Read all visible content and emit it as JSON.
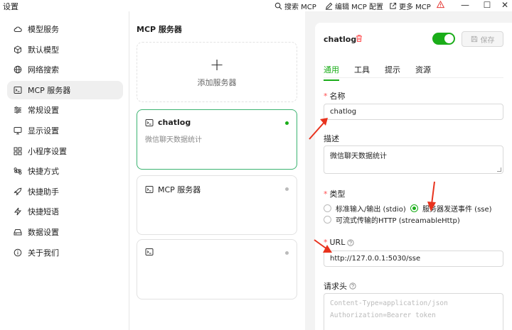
{
  "window": {
    "title": "设置",
    "actions": [
      {
        "icon": "search-icon",
        "label": "搜索 MCP"
      },
      {
        "icon": "edit-icon",
        "label": "编辑 MCP 配置"
      },
      {
        "icon": "external-link-icon",
        "label": "更多 MCP"
      }
    ],
    "controls": {
      "minimize": "—",
      "maximize": "☐",
      "close": "✕"
    }
  },
  "sidebar": {
    "items": [
      {
        "label": "模型服务",
        "icon": "cloud-icon"
      },
      {
        "label": "默认模型",
        "icon": "cube-icon"
      },
      {
        "label": "网络搜索",
        "icon": "globe-icon"
      },
      {
        "label": "MCP 服务器",
        "icon": "terminal-icon",
        "active": true
      },
      {
        "label": "常规设置",
        "icon": "sliders-icon"
      },
      {
        "label": "显示设置",
        "icon": "monitor-icon"
      },
      {
        "label": "小程序设置",
        "icon": "grid-icon"
      },
      {
        "label": "快捷方式",
        "icon": "command-icon"
      },
      {
        "label": "快捷助手",
        "icon": "rocket-icon"
      },
      {
        "label": "快捷短语",
        "icon": "zap-icon"
      },
      {
        "label": "数据设置",
        "icon": "hard-drive-icon"
      },
      {
        "label": "关于我们",
        "icon": "info-icon"
      }
    ]
  },
  "servers": {
    "title": "MCP 服务器",
    "add_label": "添加服务器",
    "plus": "+",
    "cards": [
      {
        "name": "chatlog",
        "desc": "微信聊天数据统计"
      },
      {
        "name": "MCP 服务器",
        "desc": ""
      },
      {
        "name": "",
        "desc": ""
      }
    ]
  },
  "detail": {
    "name": "chatlog",
    "save_label": "保存",
    "tabs": [
      "通用",
      "工具",
      "提示",
      "资源"
    ],
    "name_label": "名称",
    "name_value": "chatlog",
    "desc_label": "描述",
    "desc_value": "微信聊天数据统计",
    "type_label": "类型",
    "type_options": [
      "标准输入/输出 (stdio)",
      "服务器发送事件 (sse)",
      "可流式传输的HTTP (streamableHttp)"
    ],
    "type_selected": 1,
    "url_label": "URL",
    "url_value": "http://127.0.0.1:5030/sse",
    "headers_label": "请求头",
    "headers_placeholder": [
      "Content-Type=application/json",
      "Authorization=Bearer token"
    ],
    "required_mark": "*",
    "enabled": true
  },
  "colors": {
    "accent": "#1aad19",
    "required": "#ff4d4f",
    "annotation": "#e8321d"
  }
}
